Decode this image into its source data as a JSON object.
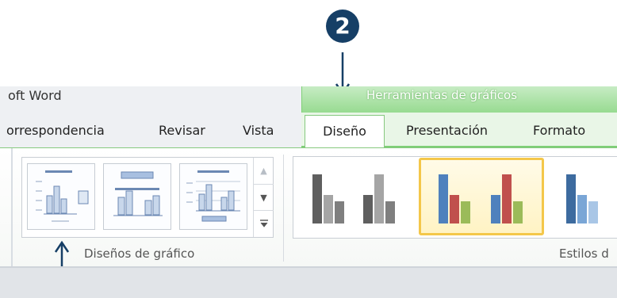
{
  "callout": {
    "number": "2",
    "color": "#163f66"
  },
  "window": {
    "app_title": "oft Word",
    "contextual_group_title": "Herramientas de gráficos"
  },
  "tabs": [
    {
      "label": "orrespondencia"
    },
    {
      "label": "Revisar"
    },
    {
      "label": "Vista"
    },
    {
      "label": "Diseño",
      "active": true
    },
    {
      "label": "Presentación"
    },
    {
      "label": "Formato"
    }
  ],
  "ribbon": {
    "layouts_group": {
      "label": "Diseños de gráfico",
      "thumbnails": [
        "layout-1",
        "layout-2",
        "layout-3"
      ]
    },
    "styles_group": {
      "label": "Estilos d",
      "thumbnails": [
        {
          "name": "gray-style",
          "colors": [
            "#5f5f5f",
            "#a5a5a5",
            "#7f7f7f"
          ]
        },
        {
          "name": "color-style",
          "colors": [
            "#4f81bd",
            "#c0504d",
            "#9bbb59"
          ],
          "selected": true
        },
        {
          "name": "blue-style",
          "colors": [
            "#3d6b9f",
            "#7aa6d6"
          ]
        }
      ]
    },
    "scroll_icons": [
      "scroll-up-icon",
      "scroll-down-icon",
      "more-icon"
    ]
  },
  "colors": {
    "contextual_green": "#93d98c",
    "selection_gold": "#f4c74a"
  }
}
